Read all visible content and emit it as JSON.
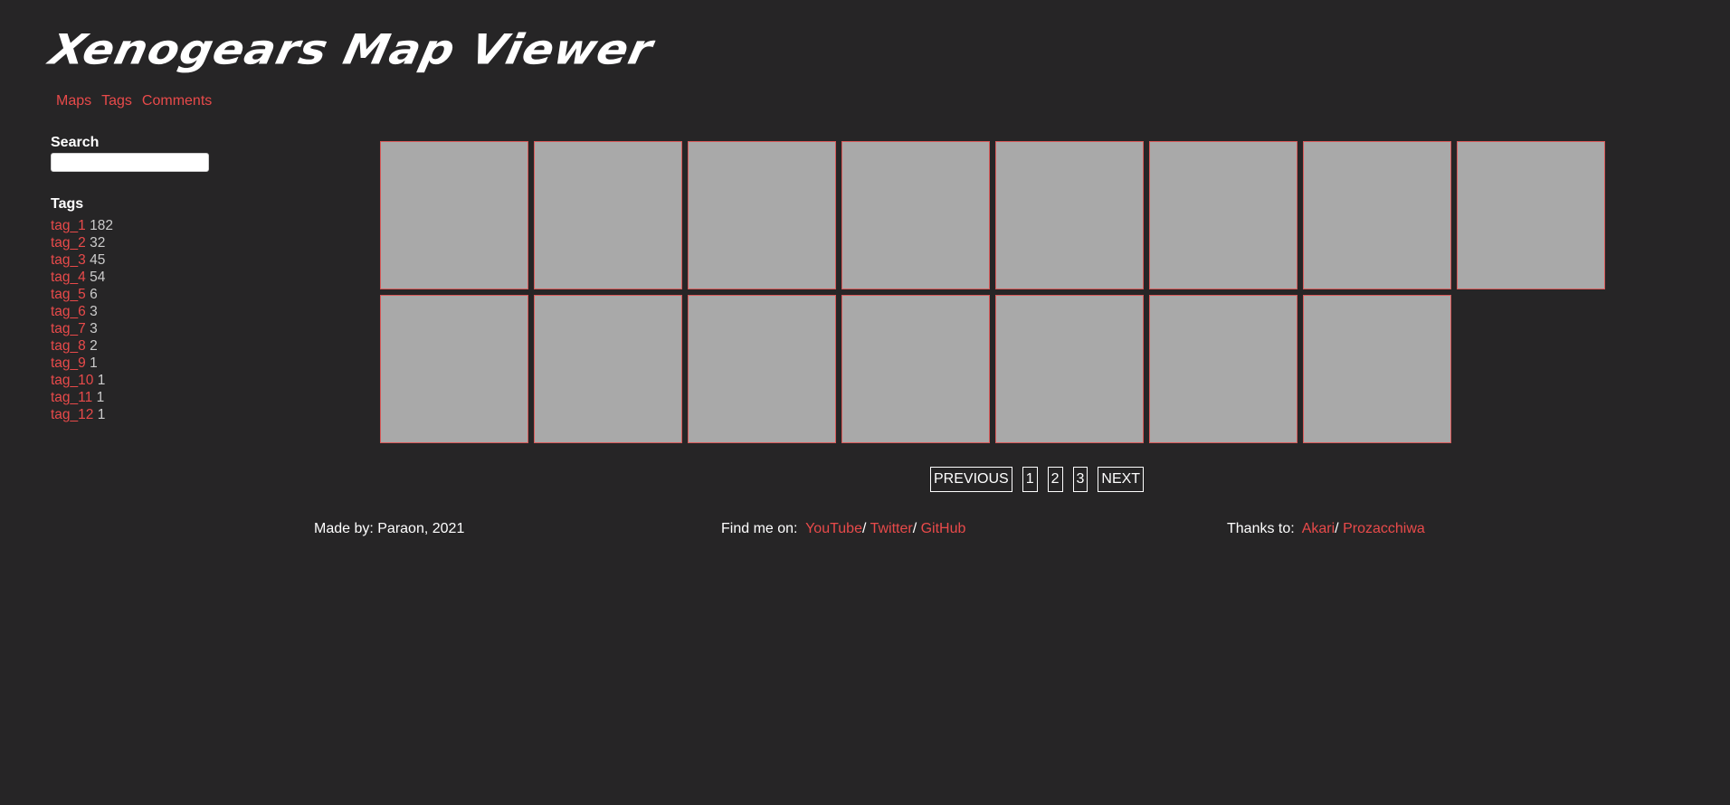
{
  "header": {
    "title": "Xenogears Map Viewer"
  },
  "nav": {
    "items": [
      "Maps",
      "Tags",
      "Comments"
    ]
  },
  "sidebar": {
    "search_label": "Search",
    "search_value": "",
    "tags_label": "Tags",
    "tags": [
      {
        "name": "tag_1",
        "count": "182"
      },
      {
        "name": "tag_2",
        "count": "32"
      },
      {
        "name": "tag_3",
        "count": "45"
      },
      {
        "name": "tag_4",
        "count": "54"
      },
      {
        "name": "tag_5",
        "count": "6"
      },
      {
        "name": "tag_6",
        "count": "3"
      },
      {
        "name": "tag_7",
        "count": "3"
      },
      {
        "name": "tag_8",
        "count": "2"
      },
      {
        "name": "tag_9",
        "count": "1"
      },
      {
        "name": "tag_10",
        "count": "1"
      },
      {
        "name": "tag_11",
        "count": "1"
      },
      {
        "name": "tag_12",
        "count": "1"
      }
    ]
  },
  "gallery": {
    "tile_count": 15,
    "tile_color": "#a9a9a9",
    "tile_border_color": "#d95a5a"
  },
  "pagination": {
    "previous": "PREVIOUS",
    "pages": [
      "1",
      "2",
      "3"
    ],
    "next": "NEXT"
  },
  "footer": {
    "made_by": "Made by: Paraon, 2021",
    "find_me_label": "Find me on:",
    "find_me_links": [
      "YouTube",
      "Twitter",
      "GitHub"
    ],
    "thanks_label": "Thanks to:",
    "thanks_links": [
      "Akari",
      "Prozacchiwa"
    ]
  },
  "colors": {
    "background": "#262526",
    "link": "#e84a4a",
    "text": "#ffffff"
  }
}
